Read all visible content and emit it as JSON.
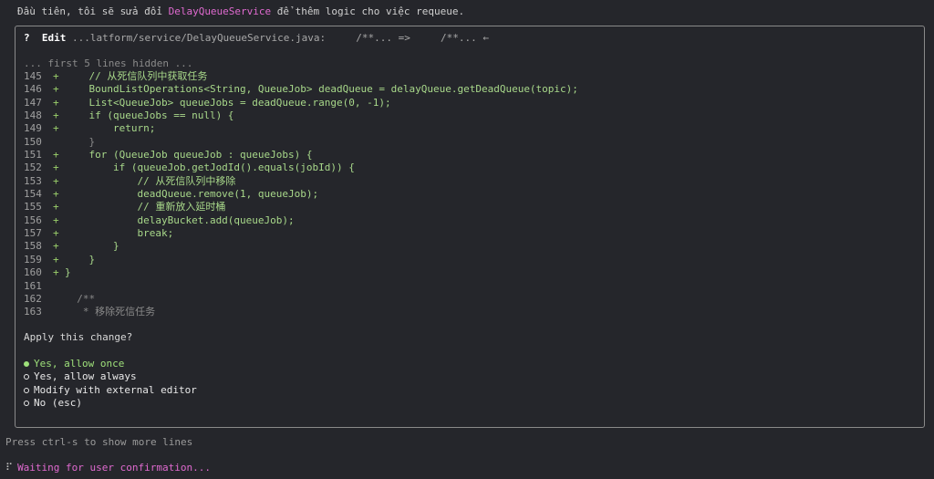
{
  "intro": {
    "prefix": "Đầu tiên, tôi sẽ sửa đổi ",
    "highlight": "DelayQueueService",
    "suffix": " để thêm logic cho việc requeue."
  },
  "header": {
    "symbol": "?",
    "title": "Edit",
    "path": " ...latform/service/DelayQueueService.java:     /**... =>     /**... ",
    "arrow_icon": "←"
  },
  "diff": {
    "hidden_note": "... first 5 lines hidden ...",
    "lines": [
      {
        "num": "145",
        "mark": "+",
        "text": "    // 从死信队列中获取任务",
        "kind": "add"
      },
      {
        "num": "146",
        "mark": "+",
        "text": "    BoundListOperations<String, QueueJob> deadQueue = delayQueue.getDeadQueue(topic);",
        "kind": "add"
      },
      {
        "num": "147",
        "mark": "+",
        "text": "    List<QueueJob> queueJobs = deadQueue.range(0, -1);",
        "kind": "add"
      },
      {
        "num": "148",
        "mark": "+",
        "text": "    if (queueJobs == null) {",
        "kind": "add"
      },
      {
        "num": "149",
        "mark": "+",
        "text": "        return;",
        "kind": "add"
      },
      {
        "num": "150",
        "mark": "",
        "text": "    }",
        "kind": "ctx"
      },
      {
        "num": "151",
        "mark": "+",
        "text": "    for (QueueJob queueJob : queueJobs) {",
        "kind": "add"
      },
      {
        "num": "152",
        "mark": "+",
        "text": "        if (queueJob.getJodId().equals(jobId)) {",
        "kind": "add"
      },
      {
        "num": "153",
        "mark": "+",
        "text": "            // 从死信队列中移除",
        "kind": "add"
      },
      {
        "num": "154",
        "mark": "+",
        "text": "            deadQueue.remove(1, queueJob);",
        "kind": "add"
      },
      {
        "num": "155",
        "mark": "+",
        "text": "            // 重新放入延时桶",
        "kind": "add"
      },
      {
        "num": "156",
        "mark": "+",
        "text": "            delayBucket.add(queueJob);",
        "kind": "add"
      },
      {
        "num": "157",
        "mark": "+",
        "text": "            break;",
        "kind": "add"
      },
      {
        "num": "158",
        "mark": "+",
        "text": "        }",
        "kind": "add"
      },
      {
        "num": "159",
        "mark": "+",
        "text": "    }",
        "kind": "add"
      },
      {
        "num": "160",
        "mark": "+",
        "text": "}",
        "kind": "add"
      },
      {
        "num": "161",
        "mark": "",
        "text": "",
        "kind": "plain"
      },
      {
        "num": "162",
        "mark": "",
        "text": "  /**",
        "kind": "ctx"
      },
      {
        "num": "163",
        "mark": "",
        "text": "   * 移除死信任务",
        "kind": "ctx"
      }
    ]
  },
  "prompt": {
    "question": "Apply this change?",
    "options": [
      {
        "label": "Yes, allow once",
        "selected": true
      },
      {
        "label": "Yes, allow always",
        "selected": false
      },
      {
        "label": "Modify with external editor",
        "selected": false
      },
      {
        "label": "No (esc)",
        "selected": false
      }
    ]
  },
  "footer": {
    "hint": "Press ctrl-s to show more lines",
    "spinner": "⠏",
    "status": "Waiting for user confirmation..."
  },
  "colors": {
    "background": "#25262b",
    "accent_pink": "#e06ad0",
    "added_green": "#a8d88a",
    "selected_green": "#9ee07a",
    "border": "#8a8a8a"
  }
}
